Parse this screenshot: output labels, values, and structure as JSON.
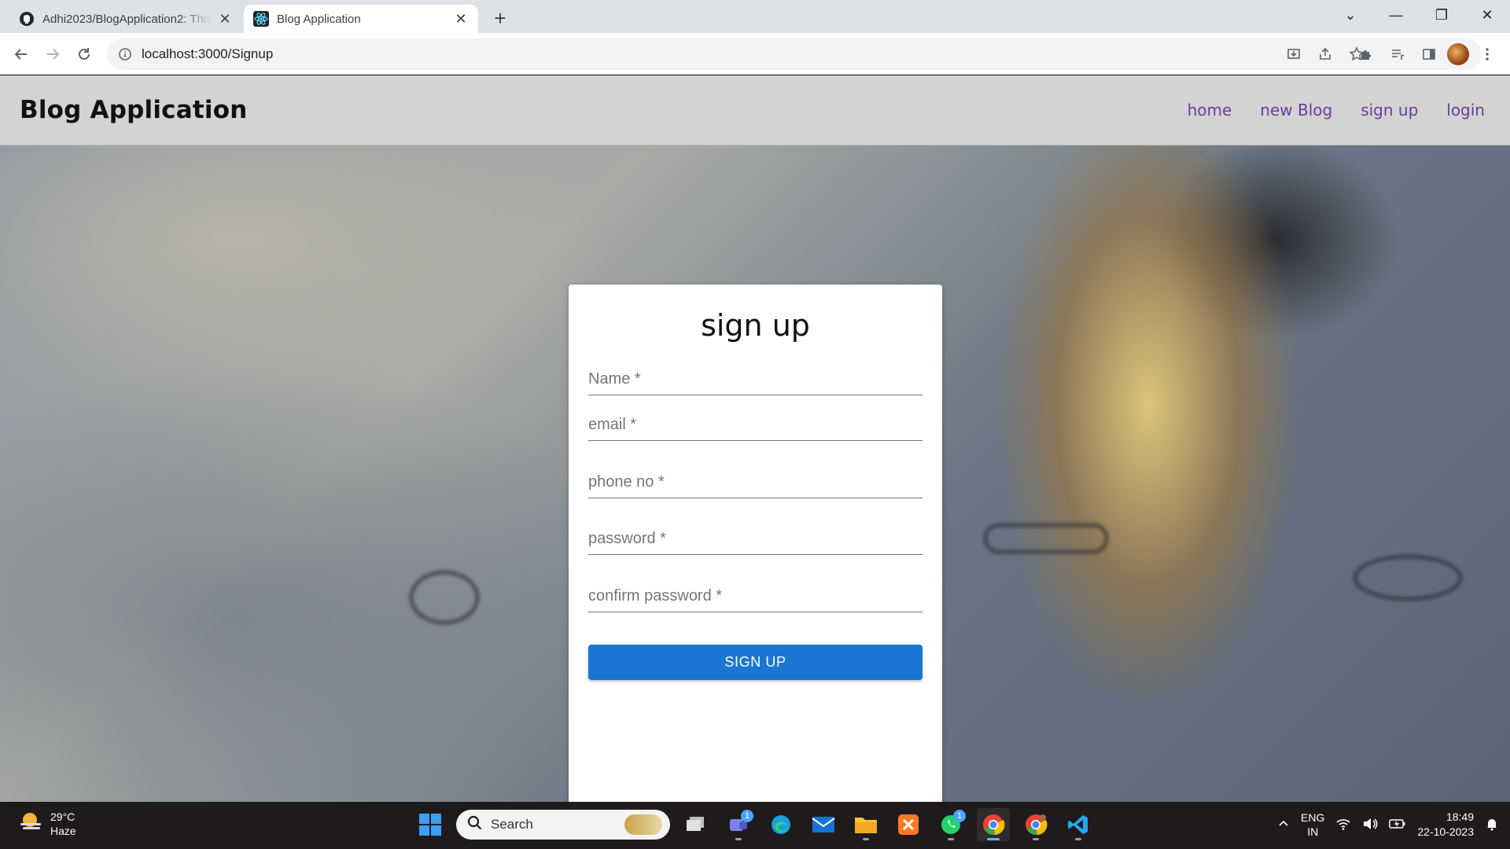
{
  "browser": {
    "tabs": [
      {
        "title": "Adhi2023/BlogApplication2: This",
        "icon": "github-icon",
        "active": false
      },
      {
        "title": "Blog Application",
        "icon": "react-icon",
        "active": true
      }
    ],
    "url": "localhost:3000/Signup"
  },
  "site": {
    "brand": "Blog Application",
    "nav": [
      "home",
      "new Blog",
      "sign up",
      "login"
    ]
  },
  "form": {
    "title": "sign up",
    "fields": [
      {
        "label": "Name *"
      },
      {
        "label": "email *"
      },
      {
        "label": "phone no *"
      },
      {
        "label": "password *"
      },
      {
        "label": "confirm password *"
      }
    ],
    "submit_label": "SIGN UP",
    "accent_color": "#1976d2"
  },
  "taskbar": {
    "weather": {
      "temp": "29°C",
      "condition": "Haze"
    },
    "search_label": "Search",
    "badges": {
      "teams": "1",
      "whatsapp": "1"
    },
    "language": {
      "line1": "ENG",
      "line2": "IN"
    },
    "time": "18:49",
    "date": "22-10-2023"
  }
}
